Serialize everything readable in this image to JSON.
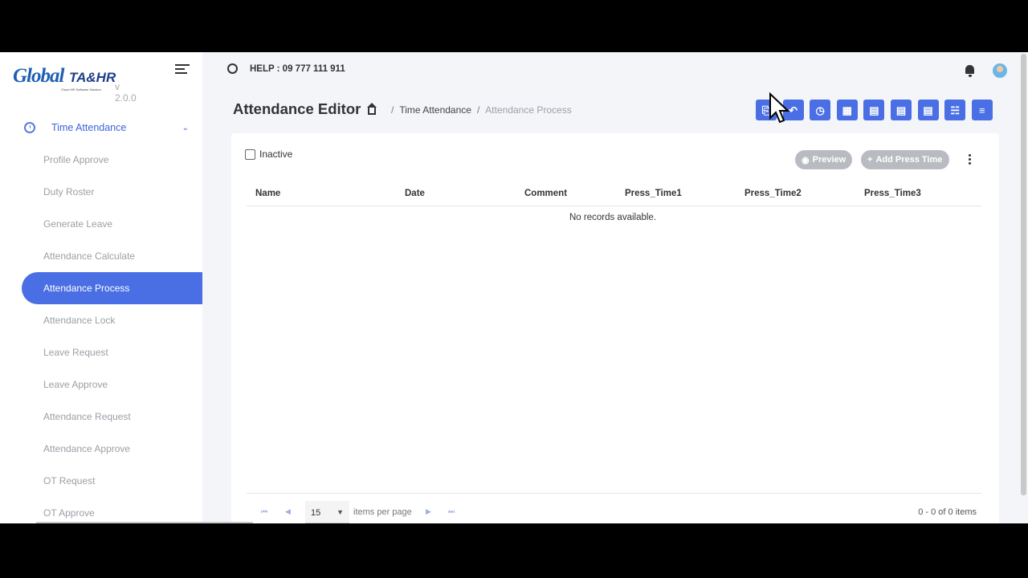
{
  "brand": {
    "word": "Global",
    "suffix": "TA&HR",
    "tagline": "Cloud HR Software Solution",
    "version": "v 2.0.0"
  },
  "sidebar": {
    "section": "Time Attendance",
    "items": [
      {
        "label": "Profile Approve"
      },
      {
        "label": "Duty Roster"
      },
      {
        "label": "Generate Leave"
      },
      {
        "label": "Attendance Calculate"
      },
      {
        "label": "Attendance Process",
        "active": true
      },
      {
        "label": "Attendance Lock"
      },
      {
        "label": "Leave Request"
      },
      {
        "label": "Leave Approve"
      },
      {
        "label": "Attendance Request"
      },
      {
        "label": "Attendance Approve"
      },
      {
        "label": "OT Request"
      },
      {
        "label": "OT Approve"
      }
    ]
  },
  "topbar": {
    "help": "HELP : 09 777 111 911"
  },
  "page": {
    "title": "Attendance Editor",
    "breadcrumb": {
      "parent": "Time Attendance",
      "current": "Attendance Process"
    }
  },
  "toolbar": {
    "buttons": [
      "import-icon",
      "undo-icon",
      "alarm-add-icon",
      "calculator-icon",
      "process-icon",
      "report-icon",
      "transfer-icon",
      "hierarchy-icon",
      "filter-icon"
    ]
  },
  "filters": {
    "inactive_label": "Inactive"
  },
  "actions": {
    "preview": "Preview",
    "add_press_time": "Add Press Time"
  },
  "table": {
    "columns": [
      "Name",
      "Date",
      "Comment",
      "Press_Time1",
      "Press_Time2",
      "Press_Time3"
    ],
    "empty_message": "No records available."
  },
  "pager": {
    "page_size": "15",
    "items_per_page": "items per page",
    "count": "0 - 0 of 0 items"
  },
  "colors": {
    "accent": "#4a6fe4",
    "muted": "#9aa0a6",
    "disabled_button": "#b8bcc2"
  }
}
